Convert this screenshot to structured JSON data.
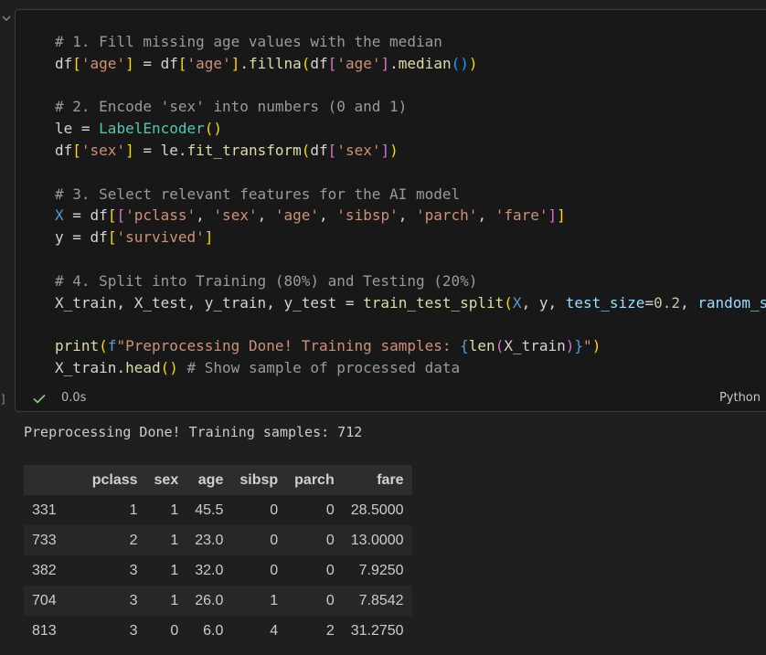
{
  "code_lines": [
    [
      {
        "t": "# 1. Fill missing age values with the median",
        "c": "c-com"
      }
    ],
    [
      {
        "t": "df",
        "c": "c-pl"
      },
      {
        "t": "[",
        "c": "c-b1"
      },
      {
        "t": "'age'",
        "c": "c-str"
      },
      {
        "t": "]",
        "c": "c-b1"
      },
      {
        "t": " = ",
        "c": "c-pl"
      },
      {
        "t": "df",
        "c": "c-pl"
      },
      {
        "t": "[",
        "c": "c-b1"
      },
      {
        "t": "'age'",
        "c": "c-str"
      },
      {
        "t": "]",
        "c": "c-b1"
      },
      {
        "t": ".",
        "c": "c-pl"
      },
      {
        "t": "fillna",
        "c": "c-fn"
      },
      {
        "t": "(",
        "c": "c-b1"
      },
      {
        "t": "df",
        "c": "c-pl"
      },
      {
        "t": "[",
        "c": "c-b2"
      },
      {
        "t": "'age'",
        "c": "c-str"
      },
      {
        "t": "]",
        "c": "c-b2"
      },
      {
        "t": ".",
        "c": "c-pl"
      },
      {
        "t": "median",
        "c": "c-fn"
      },
      {
        "t": "()",
        "c": "c-b3"
      },
      {
        "t": ")",
        "c": "c-b1"
      }
    ],
    [],
    [
      {
        "t": "# 2. Encode 'sex' into numbers (0 and 1)",
        "c": "c-com"
      }
    ],
    [
      {
        "t": "le",
        "c": "c-pl"
      },
      {
        "t": " = ",
        "c": "c-pl"
      },
      {
        "t": "LabelEncoder",
        "c": "c-cls"
      },
      {
        "t": "()",
        "c": "c-b1"
      }
    ],
    [
      {
        "t": "df",
        "c": "c-pl"
      },
      {
        "t": "[",
        "c": "c-b1"
      },
      {
        "t": "'sex'",
        "c": "c-str"
      },
      {
        "t": "]",
        "c": "c-b1"
      },
      {
        "t": " = ",
        "c": "c-pl"
      },
      {
        "t": "le",
        "c": "c-pl"
      },
      {
        "t": ".",
        "c": "c-pl"
      },
      {
        "t": "fit_transform",
        "c": "c-fn"
      },
      {
        "t": "(",
        "c": "c-b1"
      },
      {
        "t": "df",
        "c": "c-pl"
      },
      {
        "t": "[",
        "c": "c-b2"
      },
      {
        "t": "'sex'",
        "c": "c-str"
      },
      {
        "t": "]",
        "c": "c-b2"
      },
      {
        "t": ")",
        "c": "c-b1"
      }
    ],
    [],
    [
      {
        "t": "# 3. Select relevant features for the AI model",
        "c": "c-com"
      }
    ],
    [
      {
        "t": "X",
        "c": "c-kw"
      },
      {
        "t": " = ",
        "c": "c-pl"
      },
      {
        "t": "df",
        "c": "c-pl"
      },
      {
        "t": "[",
        "c": "c-b1"
      },
      {
        "t": "[",
        "c": "c-b2"
      },
      {
        "t": "'pclass'",
        "c": "c-str"
      },
      {
        "t": ", ",
        "c": "c-pl"
      },
      {
        "t": "'sex'",
        "c": "c-str"
      },
      {
        "t": ", ",
        "c": "c-pl"
      },
      {
        "t": "'age'",
        "c": "c-str"
      },
      {
        "t": ", ",
        "c": "c-pl"
      },
      {
        "t": "'sibsp'",
        "c": "c-str"
      },
      {
        "t": ", ",
        "c": "c-pl"
      },
      {
        "t": "'parch'",
        "c": "c-str"
      },
      {
        "t": ", ",
        "c": "c-pl"
      },
      {
        "t": "'fare'",
        "c": "c-str"
      },
      {
        "t": "]",
        "c": "c-b2"
      },
      {
        "t": "]",
        "c": "c-b1"
      }
    ],
    [
      {
        "t": "y",
        "c": "c-pl"
      },
      {
        "t": " = ",
        "c": "c-pl"
      },
      {
        "t": "df",
        "c": "c-pl"
      },
      {
        "t": "[",
        "c": "c-b1"
      },
      {
        "t": "'survived'",
        "c": "c-str"
      },
      {
        "t": "]",
        "c": "c-b1"
      }
    ],
    [],
    [
      {
        "t": "# 4. Split into Training (80%) and Testing (20%)",
        "c": "c-com"
      }
    ],
    [
      {
        "t": "X_train, X_test, y_train, y_test",
        "c": "c-pl"
      },
      {
        "t": " = ",
        "c": "c-pl"
      },
      {
        "t": "train_test_split",
        "c": "c-fn"
      },
      {
        "t": "(",
        "c": "c-b1"
      },
      {
        "t": "X",
        "c": "c-kw"
      },
      {
        "t": ", y, ",
        "c": "c-pl"
      },
      {
        "t": "test_size",
        "c": "c-var"
      },
      {
        "t": "=",
        "c": "c-pl"
      },
      {
        "t": "0.2",
        "c": "c-num"
      },
      {
        "t": ", ",
        "c": "c-pl"
      },
      {
        "t": "random_s",
        "c": "c-var"
      }
    ],
    [],
    [
      {
        "t": "print",
        "c": "c-fn"
      },
      {
        "t": "(",
        "c": "c-b1"
      },
      {
        "t": "f",
        "c": "c-kw"
      },
      {
        "t": "\"Preprocessing Done! Training samples: ",
        "c": "c-str"
      },
      {
        "t": "{",
        "c": "c-kw"
      },
      {
        "t": "len",
        "c": "c-fn"
      },
      {
        "t": "(",
        "c": "c-b2"
      },
      {
        "t": "X_train",
        "c": "c-pl"
      },
      {
        "t": ")",
        "c": "c-b2"
      },
      {
        "t": "}",
        "c": "c-kw"
      },
      {
        "t": "\"",
        "c": "c-str"
      },
      {
        "t": ")",
        "c": "c-b1"
      }
    ],
    [
      {
        "t": "X_train",
        "c": "c-pl"
      },
      {
        "t": ".",
        "c": "c-pl"
      },
      {
        "t": "head",
        "c": "c-fn"
      },
      {
        "t": "()",
        "c": "c-b1"
      },
      {
        "t": " # Show sample of processed data",
        "c": "c-com"
      }
    ]
  ],
  "status": {
    "duration": "0.0s",
    "language": "Python",
    "bracket": "]"
  },
  "output_text": "Preprocessing Done! Training samples: 712",
  "table": {
    "columns": [
      "pclass",
      "sex",
      "age",
      "sibsp",
      "parch",
      "fare"
    ],
    "rows": [
      {
        "index": "331",
        "values": [
          "1",
          "1",
          "45.5",
          "0",
          "0",
          "28.5000"
        ]
      },
      {
        "index": "733",
        "values": [
          "2",
          "1",
          "23.0",
          "0",
          "0",
          "13.0000"
        ]
      },
      {
        "index": "382",
        "values": [
          "3",
          "1",
          "32.0",
          "0",
          "0",
          "7.9250"
        ]
      },
      {
        "index": "704",
        "values": [
          "3",
          "1",
          "26.0",
          "1",
          "0",
          "7.8542"
        ]
      },
      {
        "index": "813",
        "values": [
          "3",
          "0",
          "6.0",
          "4",
          "2",
          "31.2750"
        ]
      }
    ]
  }
}
